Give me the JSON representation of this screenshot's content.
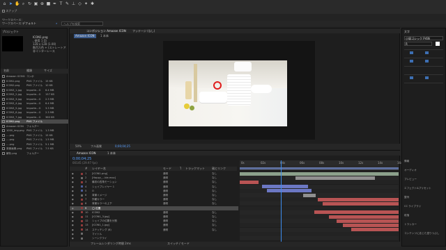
{
  "toolbar": {
    "workspace_label": "ワークスペース:",
    "workspace_value": "デフォルト",
    "search_placeholder": "ヘルプを検索",
    "snap_label": "スナップ"
  },
  "project": {
    "title": "プロジェクト",
    "item_name": "ICON1.png",
    "item_info_1": ", 使用 1 回",
    "item_info_2": "128 x 128 (1.00)",
    "item_info_3": "数百万色 + (ストレートアルファ)",
    "item_info_4": "非インターレース",
    "columns": [
      "名前",
      "種類",
      "サイズ"
    ],
    "rows": [
      {
        "name": "Amazon ICON1",
        "type": "コンポ",
        "size": ""
      },
      {
        "name": "ICON1.png",
        "type": "PNG ファイル",
        "size": "15 KB"
      },
      {
        "name": "ICON2.png",
        "type": "PNG ファイル",
        "size": "10 KB"
      },
      {
        "name": "ICON3_1.jpg",
        "type": "Importe...G",
        "size": "6.4 MB"
      },
      {
        "name": "ICON3_2.jpg",
        "type": "Importe...G",
        "size": "157 KB"
      },
      {
        "name": "ICON3_3.jpg",
        "type": "Importe...G",
        "size": "2.3 MB"
      },
      {
        "name": "ICON3_4.jpg",
        "type": "Importe...G",
        "size": "6.4 MB"
      },
      {
        "name": "ICON3_5.jpg",
        "type": "Importe...G",
        "size": "3.3 MB"
      },
      {
        "name": "ICON3_6.jpg",
        "type": "Importe...G",
        "size": "2.3 MB"
      },
      {
        "name": "ICON3_7.jpg",
        "type": "Importe...G",
        "size": "360 KB"
      },
      {
        "name": "ICON1.png",
        "type": "PNG ファイル",
        "size": ""
      },
      {
        "name": "Amazon ICON",
        "type": "フォルダー",
        "size": ""
      },
      {
        "name": "1000_img.png",
        "type": "PNG ファイル",
        "size": "1.3 MB"
      },
      {
        "name": "....png",
        "type": "PNG ファイル",
        "size": "15 KB"
      },
      {
        "name": "....png",
        "type": "PNG ファイル",
        "size": "1.5 MB"
      },
      {
        "name": "....png",
        "type": "PNG ファイル",
        "size": "5.1 MB"
      },
      {
        "name": "背景画像.png",
        "type": "PNG ファイル",
        "size": "7.5 KB"
      },
      {
        "name": "解析.png",
        "type": "フォルダー",
        "size": ""
      }
    ]
  },
  "viewer": {
    "tab_label": "コンポジション Amazon ICON",
    "footage_tab": "フッテージ (なし)",
    "crumb_1": "Amazon ICON",
    "crumb_2": "1 本体",
    "zoom": "50%",
    "timecode_small": "0;00;04;25",
    "resolution": "フル画質"
  },
  "timeline": {
    "tab_1": "Amazon ICON",
    "tab_2": "1 本体",
    "timecode": "0;00;04;25",
    "frame_info": "00145 (29.97 fps)",
    "col_headers": [
      "#",
      "レイヤー名",
      "モード",
      "T",
      "トラックマット",
      "親とリンク"
    ],
    "layers": [
      {
        "num": "1",
        "name": "[ICON1.png]",
        "mode": "通常",
        "parent": "なし",
        "color": "#8e3b3b"
      },
      {
        "num": "2",
        "name": "[Happy_...ble.mov]",
        "mode": "通常",
        "parent": "なし",
        "color": "#6b6b6b"
      },
      {
        "num": "3",
        "name": "最初の四角モーション",
        "mode": "通常",
        "parent": "なし",
        "color": "#8e3b3b"
      },
      {
        "num": "4",
        "name": "シェイプレイヤー 1",
        "mode": "通常",
        "parent": "なし",
        "color": "#4b5c9a"
      },
      {
        "num": "5",
        "name": "O",
        "mode": "通常",
        "parent": "なし",
        "color": "#4b5c9a"
      },
      {
        "num": "6",
        "name": "背景イメージ",
        "mode": "通常",
        "parent": "なし",
        "color": "#6b6b6b"
      },
      {
        "num": "7",
        "name": "外観カラー",
        "mode": "通常",
        "parent": "なし",
        "color": "#8e3b3b"
      },
      {
        "num": "8",
        "name": "背景カラーの上下",
        "mode": "通常",
        "parent": "なし",
        "color": "#8e3b3b"
      },
      {
        "num": "9",
        "name": "◯ 位置",
        "mode": "",
        "parent": "",
        "color": "#8e3b3b"
      },
      {
        "num": "10",
        "name": "ICON2",
        "mode": "通常",
        "parent": "なし",
        "color": "#8e3b3b"
      },
      {
        "num": "11",
        "name": "[ICON1_3.jpg]",
        "mode": "通常",
        "parent": "なし",
        "color": "#8e3b3b"
      },
      {
        "num": "12",
        "name": "シェイプの位置を分割",
        "mode": "通常",
        "parent": "なし",
        "color": "#8e3b3b"
      },
      {
        "num": "13",
        "name": "[ICON1_1.jpg]",
        "mode": "通常",
        "parent": "なし",
        "color": "#8e3b3b"
      },
      {
        "num": "14",
        "name": "ステッチング (8)",
        "mode": "通常",
        "parent": "なし",
        "color": "#8e3b3b"
      },
      {
        "num": "",
        "name": "マイトル",
        "mode": "",
        "parent": "",
        "color": "#6b6b6b"
      },
      {
        "num": "",
        "name": "シーンクライ",
        "mode": "",
        "parent": "",
        "color": "#6b6b6b"
      }
    ],
    "ruler": [
      "0s",
      "02s",
      "04s",
      "06s",
      "08s",
      "10s",
      "12s",
      "14s",
      "16s"
    ],
    "footer_label": "フレームレンダリング時間 2ms",
    "footer_mode": "スイッチ / モード"
  },
  "right_panel": {
    "title": "文字",
    "font": "小塚ゴシック Pr6N",
    "style": "R",
    "effects_items": [
      "情報",
      "オーディオ",
      "プレビュー",
      "エフェクト&プリセット",
      "整列",
      "CC ライブラリ",
      "段落",
      "トラッカー",
      "コンテンツに応じた塗りつぶし"
    ]
  },
  "tracks": [
    {
      "start": 0.0,
      "end": 1.0,
      "color": "#8ca18c"
    },
    {
      "start": 0.35,
      "end": 0.85,
      "color": "#909090"
    },
    {
      "start": 0.0,
      "end": 0.12,
      "color": "#b85454"
    },
    {
      "start": 0.14,
      "end": 0.43,
      "color": "#6c78c4"
    },
    {
      "start": 0.17,
      "end": 0.45,
      "color": "#6c78c4"
    },
    {
      "start": 0.4,
      "end": 0.48,
      "color": "#909090"
    },
    {
      "start": 0.49,
      "end": 1.0,
      "color": "#b85454"
    },
    {
      "start": 0.52,
      "end": 1.0,
      "color": "#b85454"
    },
    {
      "start": 0.0,
      "end": 0.0,
      "color": "#b85454"
    },
    {
      "start": 0.47,
      "end": 1.0,
      "color": "#b85454"
    },
    {
      "start": 0.56,
      "end": 1.0,
      "color": "#b85454"
    },
    {
      "start": 0.61,
      "end": 1.0,
      "color": "#b85454"
    },
    {
      "start": 0.65,
      "end": 1.0,
      "color": "#b85454"
    },
    {
      "start": 0.7,
      "end": 1.0,
      "color": "#b85454"
    },
    {
      "start": 0.0,
      "end": 0.0,
      "color": "#909090"
    },
    {
      "start": 0.0,
      "end": 0.0,
      "color": "#909090"
    }
  ]
}
